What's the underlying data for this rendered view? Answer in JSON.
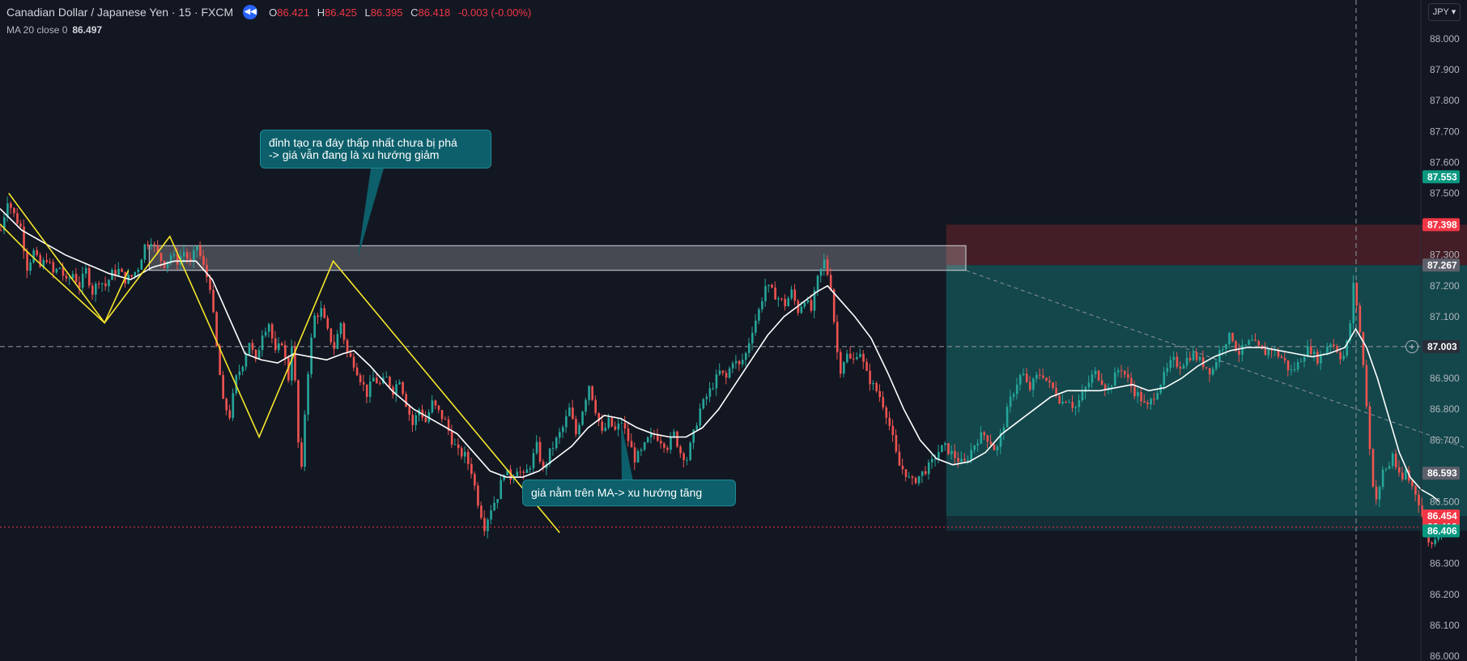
{
  "header": {
    "symbol": "Canadian Dollar / Japanese Yen · 15 · FXCM",
    "o_label": "O",
    "o": "86.421",
    "h_label": "H",
    "h": "86.425",
    "l_label": "L",
    "l": "86.395",
    "c_label": "C",
    "c": "86.418",
    "change": "-0.003 (-0.00%)"
  },
  "indicator": {
    "label": "MA 20 close 0",
    "value": "86.497"
  },
  "currency": "JPY",
  "annotations": {
    "top_note": "đỉnh tạo ra đáy thấp nhất chưa bị phá\n-> giá vẫn đang là xu hướng giảm",
    "bottom_note": "giá nằm trên MA-> xu hướng tăng"
  },
  "colors": {
    "background": "#131722",
    "up": "#26a69a",
    "down": "#ef5350",
    "ma": "#ffffff",
    "zigzag": "#f5e62a",
    "profit_zone": "#134a4e",
    "loss_zone": "#4a1f27"
  },
  "chart_data": {
    "type": "candlestick",
    "timeframe": "15",
    "ylim": [
      86.0,
      88.05
    ],
    "y_ticks": [
      "88.000",
      "87.900",
      "87.800",
      "87.700",
      "87.600",
      "87.500",
      "87.400",
      "87.300",
      "87.200",
      "87.100",
      "87.000",
      "86.900",
      "86.800",
      "86.700",
      "86.600",
      "86.500",
      "86.400",
      "86.300",
      "86.200",
      "86.100",
      "86.000"
    ],
    "price_labels": [
      {
        "value": 87.553,
        "text": "87.553",
        "color": "#089981"
      },
      {
        "value": 87.398,
        "text": "87.398",
        "color": "#f23645"
      },
      {
        "value": 87.267,
        "text": "87.267",
        "color": "#5d606b"
      },
      {
        "value": 87.003,
        "text": "87.003",
        "color": "#2a2e39"
      },
      {
        "value": 86.593,
        "text": "86.593",
        "color": "#5d606b"
      },
      {
        "value": 86.454,
        "text": "86.454",
        "color": "#f23645"
      },
      {
        "value": 86.418,
        "text": "86.418",
        "color": "#f23645"
      },
      {
        "value": 86.406,
        "text": "86.406",
        "color": "#089981"
      }
    ],
    "crosshair_price": 87.003,
    "last_price": 86.418,
    "close_path": [
      [
        0,
        87.38
      ],
      [
        6,
        87.48
      ],
      [
        12,
        87.43
      ],
      [
        18,
        87.39
      ],
      [
        24,
        87.26
      ],
      [
        30,
        87.31
      ],
      [
        36,
        87.26
      ],
      [
        42,
        87.29
      ],
      [
        48,
        87.24
      ],
      [
        54,
        87.26
      ],
      [
        60,
        87.21
      ],
      [
        66,
        87.24
      ],
      [
        72,
        87.2
      ],
      [
        78,
        87.25
      ],
      [
        84,
        87.18
      ],
      [
        90,
        87.22
      ],
      [
        96,
        87.2
      ],
      [
        102,
        87.24
      ],
      [
        108,
        87.25
      ],
      [
        114,
        87.22
      ],
      [
        120,
        87.23
      ],
      [
        126,
        87.26
      ],
      [
        132,
        87.33
      ],
      [
        138,
        87.35
      ],
      [
        144,
        87.3
      ],
      [
        150,
        87.27
      ],
      [
        156,
        87.3
      ],
      [
        162,
        87.28
      ],
      [
        168,
        87.31
      ],
      [
        174,
        87.27
      ],
      [
        180,
        87.33
      ],
      [
        186,
        87.26
      ],
      [
        192,
        87.2
      ],
      [
        198,
        87.0
      ],
      [
        204,
        86.82
      ],
      [
        210,
        86.78
      ],
      [
        216,
        86.9
      ],
      [
        222,
        86.95
      ],
      [
        228,
        87.02
      ],
      [
        234,
        86.95
      ],
      [
        240,
        87.05
      ],
      [
        246,
        87.08
      ],
      [
        252,
        86.98
      ],
      [
        258,
        87.02
      ],
      [
        264,
        86.9
      ],
      [
        268,
        87.05
      ],
      [
        272,
        86.72
      ],
      [
        276,
        86.6
      ],
      [
        280,
        86.85
      ],
      [
        284,
        87.0
      ],
      [
        288,
        87.1
      ],
      [
        294,
        87.12
      ],
      [
        300,
        87.05
      ],
      [
        306,
        87.0
      ],
      [
        312,
        87.08
      ],
      [
        318,
        86.98
      ],
      [
        324,
        86.95
      ],
      [
        330,
        86.9
      ],
      [
        336,
        86.85
      ],
      [
        342,
        86.9
      ],
      [
        348,
        86.88
      ],
      [
        354,
        86.9
      ],
      [
        360,
        86.86
      ],
      [
        366,
        86.9
      ],
      [
        372,
        86.82
      ],
      [
        378,
        86.75
      ],
      [
        384,
        86.8
      ],
      [
        390,
        86.76
      ],
      [
        396,
        86.82
      ],
      [
        402,
        86.79
      ],
      [
        408,
        86.76
      ],
      [
        414,
        86.7
      ],
      [
        420,
        86.66
      ],
      [
        426,
        86.65
      ],
      [
        432,
        86.6
      ],
      [
        438,
        86.5
      ],
      [
        444,
        86.42
      ],
      [
        450,
        86.48
      ],
      [
        456,
        86.52
      ],
      [
        462,
        86.6
      ],
      [
        468,
        86.58
      ],
      [
        474,
        86.61
      ],
      [
        480,
        86.58
      ],
      [
        486,
        86.62
      ],
      [
        492,
        86.68
      ],
      [
        498,
        86.6
      ],
      [
        504,
        86.66
      ],
      [
        510,
        86.7
      ],
      [
        516,
        86.74
      ],
      [
        522,
        86.8
      ],
      [
        528,
        86.72
      ],
      [
        534,
        86.8
      ],
      [
        540,
        86.88
      ],
      [
        546,
        86.8
      ],
      [
        552,
        86.72
      ],
      [
        558,
        86.76
      ],
      [
        564,
        86.73
      ],
      [
        570,
        86.76
      ],
      [
        576,
        86.7
      ],
      [
        582,
        86.64
      ],
      [
        588,
        86.66
      ],
      [
        594,
        86.7
      ],
      [
        600,
        86.72
      ],
      [
        606,
        86.7
      ],
      [
        612,
        86.68
      ],
      [
        618,
        86.72
      ],
      [
        624,
        86.66
      ],
      [
        630,
        86.64
      ],
      [
        636,
        86.72
      ],
      [
        642,
        86.8
      ],
      [
        648,
        86.84
      ],
      [
        654,
        86.88
      ],
      [
        660,
        86.92
      ],
      [
        666,
        86.9
      ],
      [
        672,
        86.96
      ],
      [
        678,
        86.94
      ],
      [
        684,
        86.98
      ],
      [
        690,
        87.06
      ],
      [
        696,
        87.12
      ],
      [
        702,
        87.2
      ],
      [
        708,
        87.18
      ],
      [
        714,
        87.16
      ],
      [
        720,
        87.14
      ],
      [
        726,
        87.18
      ],
      [
        732,
        87.12
      ],
      [
        738,
        87.16
      ],
      [
        744,
        87.12
      ],
      [
        750,
        87.22
      ],
      [
        756,
        87.28
      ],
      [
        762,
        87.2
      ],
      [
        766,
        87.05
      ],
      [
        770,
        86.92
      ],
      [
        776,
        86.98
      ],
      [
        782,
        86.95
      ],
      [
        788,
        87.0
      ],
      [
        794,
        86.92
      ],
      [
        800,
        86.88
      ],
      [
        806,
        86.85
      ],
      [
        812,
        86.8
      ],
      [
        818,
        86.72
      ],
      [
        824,
        86.62
      ],
      [
        830,
        86.6
      ],
      [
        836,
        86.56
      ],
      [
        842,
        86.58
      ],
      [
        848,
        86.6
      ],
      [
        854,
        86.62
      ],
      [
        860,
        86.66
      ],
      [
        866,
        86.68
      ],
      [
        872,
        86.66
      ],
      [
        878,
        86.64
      ],
      [
        884,
        86.62
      ],
      [
        890,
        86.66
      ],
      [
        896,
        86.7
      ],
      [
        902,
        86.72
      ],
      [
        908,
        86.7
      ],
      [
        914,
        86.66
      ],
      [
        920,
        86.74
      ],
      [
        926,
        86.82
      ],
      [
        932,
        86.88
      ],
      [
        938,
        86.92
      ],
      [
        944,
        86.86
      ],
      [
        950,
        86.9
      ],
      [
        956,
        86.92
      ],
      [
        962,
        86.88
      ],
      [
        968,
        86.86
      ],
      [
        974,
        86.82
      ],
      [
        980,
        86.84
      ],
      [
        986,
        86.8
      ],
      [
        992,
        86.84
      ],
      [
        998,
        86.88
      ],
      [
        1004,
        86.92
      ],
      [
        1010,
        86.9
      ],
      [
        1016,
        86.86
      ],
      [
        1022,
        86.9
      ],
      [
        1028,
        86.94
      ],
      [
        1034,
        86.9
      ],
      [
        1040,
        86.86
      ],
      [
        1046,
        86.84
      ],
      [
        1052,
        86.8
      ],
      [
        1058,
        86.84
      ],
      [
        1064,
        86.88
      ],
      [
        1070,
        86.92
      ],
      [
        1076,
        86.96
      ],
      [
        1082,
        86.94
      ],
      [
        1088,
        86.96
      ],
      [
        1094,
        86.98
      ],
      [
        1100,
        86.96
      ],
      [
        1106,
        86.94
      ],
      [
        1112,
        86.92
      ],
      [
        1118,
        86.98
      ],
      [
        1124,
        87.02
      ],
      [
        1130,
        87.04
      ],
      [
        1136,
        86.98
      ],
      [
        1142,
        87.0
      ],
      [
        1148,
        87.02
      ],
      [
        1154,
        87.0
      ],
      [
        1160,
        86.98
      ],
      [
        1166,
        87.0
      ],
      [
        1172,
        86.98
      ],
      [
        1178,
        86.96
      ],
      [
        1184,
        86.92
      ],
      [
        1190,
        86.94
      ],
      [
        1196,
        86.98
      ],
      [
        1202,
        87.0
      ],
      [
        1208,
        86.96
      ],
      [
        1214,
        86.98
      ],
      [
        1220,
        87.02
      ],
      [
        1226,
        87.0
      ],
      [
        1232,
        86.96
      ],
      [
        1238,
        87.04
      ],
      [
        1242,
        87.2
      ],
      [
        1246,
        87.12
      ],
      [
        1250,
        86.98
      ],
      [
        1254,
        86.82
      ],
      [
        1258,
        86.62
      ],
      [
        1262,
        86.5
      ],
      [
        1266,
        86.54
      ],
      [
        1270,
        86.62
      ],
      [
        1274,
        86.6
      ],
      [
        1278,
        86.66
      ],
      [
        1282,
        86.6
      ],
      [
        1286,
        86.56
      ],
      [
        1290,
        86.6
      ],
      [
        1294,
        86.56
      ],
      [
        1298,
        86.54
      ],
      [
        1302,
        86.5
      ],
      [
        1306,
        86.44
      ],
      [
        1310,
        86.38
      ],
      [
        1314,
        86.36
      ],
      [
        1318,
        86.4
      ],
      [
        1322,
        86.42
      ]
    ],
    "ma_path": [
      [
        0,
        87.45
      ],
      [
        20,
        87.38
      ],
      [
        40,
        87.34
      ],
      [
        60,
        87.3
      ],
      [
        80,
        87.27
      ],
      [
        100,
        87.24
      ],
      [
        120,
        87.22
      ],
      [
        140,
        87.26
      ],
      [
        160,
        87.28
      ],
      [
        180,
        87.28
      ],
      [
        195,
        87.22
      ],
      [
        210,
        87.1
      ],
      [
        225,
        86.98
      ],
      [
        240,
        86.96
      ],
      [
        255,
        86.95
      ],
      [
        270,
        86.98
      ],
      [
        285,
        86.97
      ],
      [
        300,
        86.96
      ],
      [
        315,
        86.98
      ],
      [
        325,
        86.99
      ],
      [
        340,
        86.94
      ],
      [
        360,
        86.86
      ],
      [
        380,
        86.8
      ],
      [
        400,
        86.76
      ],
      [
        420,
        86.72
      ],
      [
        435,
        86.66
      ],
      [
        450,
        86.6
      ],
      [
        465,
        86.58
      ],
      [
        480,
        86.58
      ],
      [
        495,
        86.6
      ],
      [
        510,
        86.64
      ],
      [
        525,
        86.68
      ],
      [
        540,
        86.74
      ],
      [
        555,
        86.78
      ],
      [
        570,
        86.77
      ],
      [
        585,
        86.74
      ],
      [
        600,
        86.72
      ],
      [
        615,
        86.71
      ],
      [
        630,
        86.71
      ],
      [
        645,
        86.74
      ],
      [
        660,
        86.8
      ],
      [
        675,
        86.88
      ],
      [
        690,
        86.96
      ],
      [
        705,
        87.04
      ],
      [
        720,
        87.1
      ],
      [
        735,
        87.14
      ],
      [
        750,
        87.18
      ],
      [
        760,
        87.2
      ],
      [
        770,
        87.16
      ],
      [
        785,
        87.1
      ],
      [
        800,
        87.03
      ],
      [
        815,
        86.92
      ],
      [
        830,
        86.8
      ],
      [
        845,
        86.7
      ],
      [
        860,
        86.64
      ],
      [
        875,
        86.62
      ],
      [
        890,
        86.63
      ],
      [
        905,
        86.66
      ],
      [
        920,
        86.72
      ],
      [
        935,
        86.76
      ],
      [
        950,
        86.8
      ],
      [
        965,
        86.84
      ],
      [
        980,
        86.86
      ],
      [
        995,
        86.86
      ],
      [
        1010,
        86.86
      ],
      [
        1025,
        86.87
      ],
      [
        1040,
        86.88
      ],
      [
        1055,
        86.86
      ],
      [
        1070,
        86.87
      ],
      [
        1085,
        86.9
      ],
      [
        1100,
        86.94
      ],
      [
        1115,
        86.97
      ],
      [
        1130,
        86.99
      ],
      [
        1145,
        87.0
      ],
      [
        1160,
        87.0
      ],
      [
        1175,
        86.99
      ],
      [
        1190,
        86.98
      ],
      [
        1205,
        86.97
      ],
      [
        1220,
        86.98
      ],
      [
        1235,
        87.0
      ],
      [
        1245,
        87.06
      ],
      [
        1255,
        87.0
      ],
      [
        1265,
        86.9
      ],
      [
        1275,
        86.78
      ],
      [
        1285,
        86.66
      ],
      [
        1295,
        86.58
      ],
      [
        1305,
        86.54
      ],
      [
        1315,
        86.52
      ],
      [
        1322,
        86.5
      ]
    ],
    "zigzag": [
      [
        8,
        87.5
      ],
      [
        96,
        87.08
      ],
      [
        156,
        87.36
      ],
      [
        238,
        86.71
      ],
      [
        306,
        87.28
      ],
      [
        514,
        86.4
      ]
    ],
    "zigzag2": [
      [
        0,
        87.4
      ],
      [
        28,
        87.3
      ],
      [
        96,
        87.08
      ],
      [
        118,
        87.25
      ]
    ],
    "resistance_zone": {
      "x0": 137,
      "x1": 887,
      "y_top": 87.33,
      "y_bottom": 87.25
    },
    "position": {
      "x0": 869,
      "x1": 1485,
      "entry": 87.267,
      "stop": 87.398,
      "target": 86.454,
      "target_edge": 86.406
    },
    "trend_line": [
      [
        887,
        87.25
      ],
      [
        1485,
        86.5
      ]
    ],
    "candle_spacing": 3,
    "x_range": [
      0,
      1330
    ]
  }
}
